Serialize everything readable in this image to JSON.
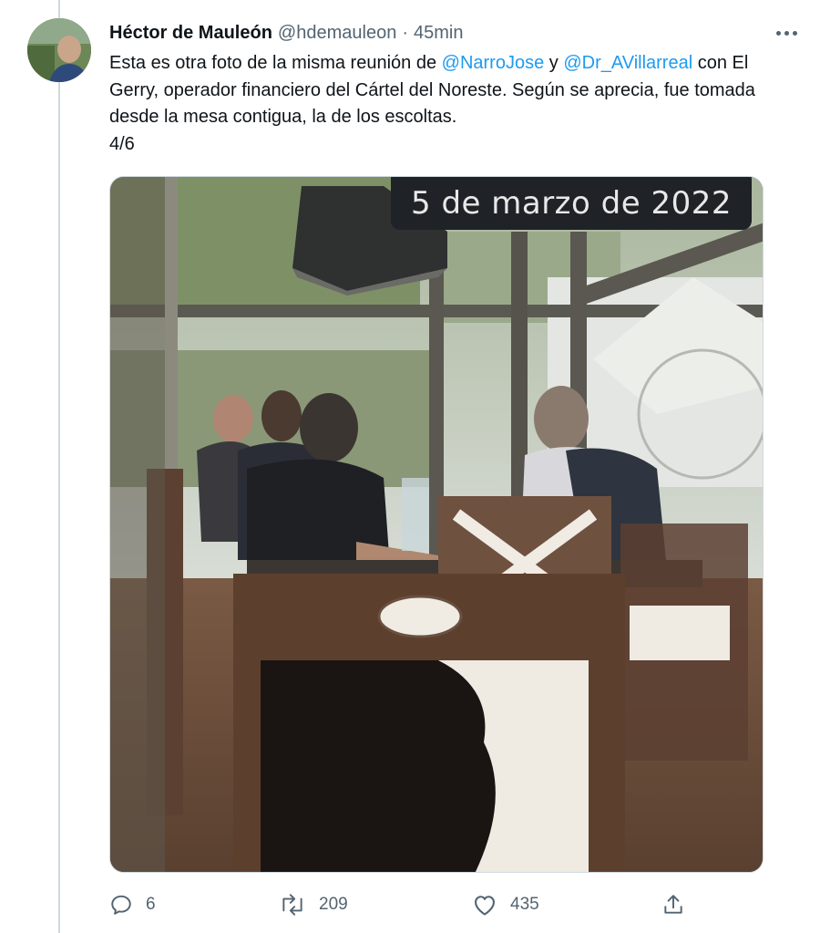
{
  "tweet": {
    "author_name": "Héctor de Mauleón",
    "author_handle": "@hdemauleon",
    "separator": "·",
    "timestamp": "45min",
    "text": {
      "part1": "Esta es otra foto de la misma reunión de ",
      "mention1": "@NarroJose",
      "part2": " y ",
      "mention2": "@Dr_AVillarreal",
      "part3": " con El Gerry, operador financiero del Cártel del Noreste. Según se aprecia, fue tomada desde la mesa contigua, la de los escoltas.",
      "counter": "4/6"
    },
    "media": {
      "date_overlay": "5 de marzo de 2022"
    },
    "actions": {
      "replies": "6",
      "retweets": "209",
      "likes": "435"
    }
  },
  "icons": {
    "reply": "reply-icon",
    "retweet": "retweet-icon",
    "like": "heart-icon",
    "share": "share-icon",
    "more": "more-icon"
  },
  "colors": {
    "accent": "#1d9bf0",
    "secondary_text": "#536471",
    "primary_text": "#0f1419",
    "thread_line": "#cfd9de"
  }
}
